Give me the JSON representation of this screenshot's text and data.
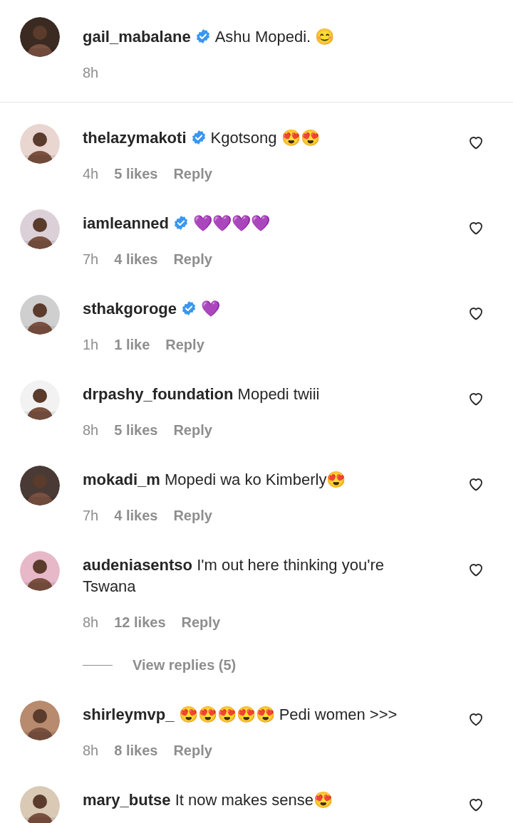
{
  "caption": {
    "username": "gail_mabalane",
    "verified": true,
    "text": "Ashu Mopedi. 😊",
    "time": "8h"
  },
  "comments": [
    {
      "username": "thelazymakoti",
      "verified": true,
      "text": "Kgotsong 😍😍",
      "time": "4h",
      "likes": "5 likes",
      "reply": "Reply",
      "liked": false
    },
    {
      "username": "iamleanned",
      "verified": true,
      "text": "💜💜💜💜",
      "time": "7h",
      "likes": "4 likes",
      "reply": "Reply",
      "liked": false
    },
    {
      "username": "sthakgoroge",
      "verified": true,
      "text": "💜",
      "time": "1h",
      "likes": "1 like",
      "reply": "Reply",
      "liked": false
    },
    {
      "username": "drpashy_foundation",
      "verified": false,
      "text": "Mopedi twiii",
      "time": "8h",
      "likes": "5 likes",
      "reply": "Reply",
      "liked": false
    },
    {
      "username": "mokadi_m",
      "verified": false,
      "text": "Mopedi wa ko Kimberly😍",
      "time": "7h",
      "likes": "4 likes",
      "reply": "Reply",
      "liked": false
    },
    {
      "username": "audeniasentso",
      "verified": false,
      "text": "I'm out here thinking you're Tswana",
      "time": "8h",
      "likes": "12 likes",
      "reply": "Reply",
      "liked": false,
      "view_replies": "View replies (5)"
    },
    {
      "username": "shirleymvp_",
      "verified": false,
      "text": "😍😍😍😍😍 Pedi women >>>",
      "time": "8h",
      "likes": "8 likes",
      "reply": "Reply",
      "liked": false
    },
    {
      "username": "mary_butse",
      "verified": false,
      "text": "It now makes sense😍",
      "liked": false
    }
  ]
}
